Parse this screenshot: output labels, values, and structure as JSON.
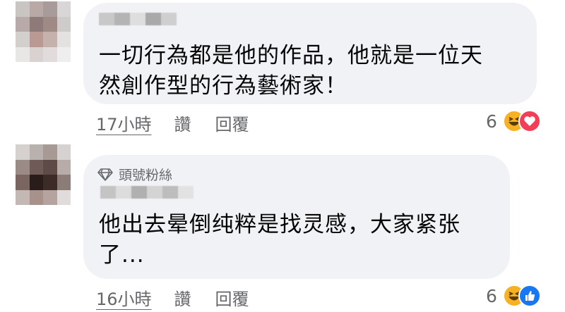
{
  "comments": [
    {
      "text_lines": [
        "一切行為都是他的作品，他就是一位天",
        "然創作型的行為藝術家！"
      ],
      "time": "17小時",
      "like_label": "讚",
      "reply_label": "回覆",
      "reaction_count": "6",
      "reactions": [
        "haha-icon",
        "love-icon"
      ]
    },
    {
      "badge": "頭號粉絲",
      "badge_icon": "diamond-icon",
      "text_lines": [
        "他出去晕倒纯粹是找灵感，大家紧张",
        "了..."
      ],
      "time": "16小時",
      "like_label": "讚",
      "reply_label": "回覆",
      "reaction_count": "6",
      "reactions": [
        "haha-icon",
        "like-icon"
      ]
    }
  ],
  "colors": {
    "bubble": "#f0f2f5",
    "meta_text": "#65676b",
    "haha": "#f7b125",
    "love": "#f33e58",
    "like": "#1877f2"
  }
}
